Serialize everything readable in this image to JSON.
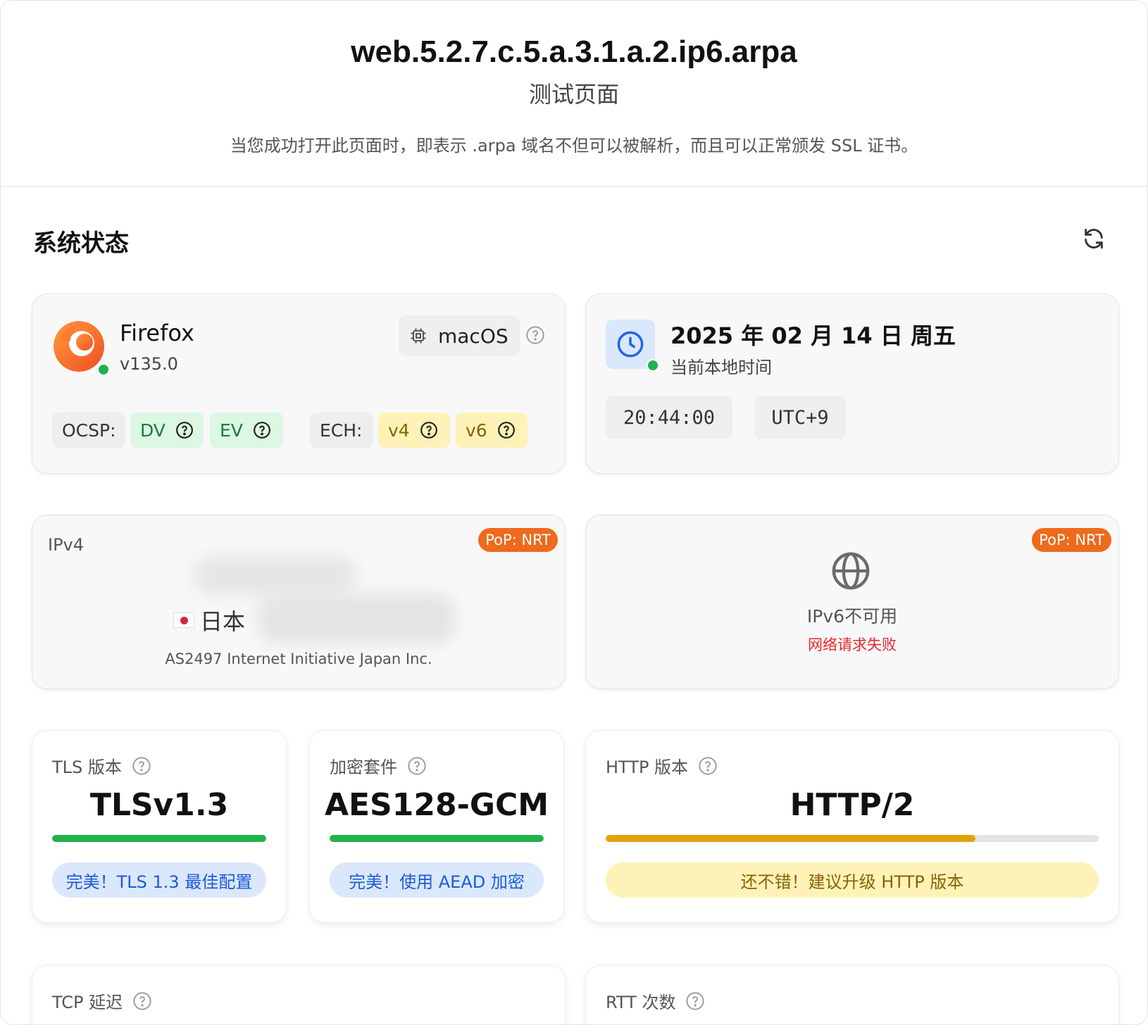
{
  "header": {
    "title": "web.5.2.7.c.5.a.3.1.a.2.ip6.arpa",
    "subtitle": "测试页面",
    "description": "当您成功打开此页面时，即表示 .arpa 域名不但可以被解析，而且可以正常颁发 SSL 证书。"
  },
  "section": {
    "title": "系统状态",
    "refresh_icon": "refresh-icon"
  },
  "browser": {
    "name": "Firefox",
    "version": "v135.0",
    "os": "macOS",
    "ocsp_label": "OCSP:",
    "ocsp": [
      "DV",
      "EV"
    ],
    "ech_label": "ECH:",
    "ech": [
      "v4",
      "v6"
    ]
  },
  "time": {
    "date": "2025 年 02 月 14 日 周五",
    "subtitle": "当前本地时间",
    "clock": "20:44:00",
    "timezone": "UTC+9"
  },
  "ipv4": {
    "label": "IPv4",
    "pop": "PoP: NRT",
    "country": "日本",
    "asn": "AS2497 Internet Initiative Japan Inc."
  },
  "ipv6": {
    "pop": "PoP: NRT",
    "status": "IPv6不可用",
    "error": "网络请求失败"
  },
  "metrics": {
    "tls": {
      "label": "TLS 版本",
      "value": "TLSv1.3",
      "progress": 1.0,
      "verdict": "完美！TLS 1.3 最佳配置"
    },
    "cipher": {
      "label": "加密套件",
      "value": "AES128-GCM",
      "progress": 1.0,
      "verdict": "完美！使用 AEAD 加密"
    },
    "http": {
      "label": "HTTP 版本",
      "value": "HTTP/2",
      "progress": 0.75,
      "verdict": "还不错！建议升级 HTTP 版本"
    },
    "tcp": {
      "label": "TCP 延迟"
    },
    "rtt": {
      "label": "RTT 次数"
    }
  },
  "colors": {
    "green": "#22b14c",
    "amber": "#e3a208",
    "pop_orange": "#ee6a1c",
    "error_red": "#e5282d",
    "blue_accent": "#1d5bd8"
  }
}
